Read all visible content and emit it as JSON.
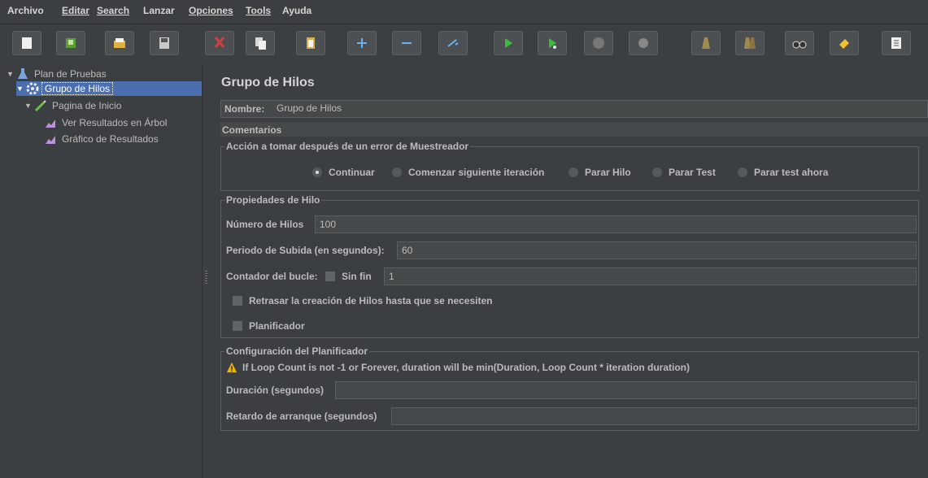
{
  "menu": {
    "items": [
      "Archivo",
      "Editar",
      "Search",
      "Lanzar",
      "Opciones",
      "Tools",
      "Ayuda"
    ]
  },
  "toolbar": {
    "buttons": [
      "new",
      "templates",
      "open",
      "save",
      "cut",
      "copy",
      "paste",
      "expand",
      "collapse",
      "toggle",
      "start",
      "start-no-pauses",
      "stop",
      "shutdown",
      "clear",
      "clear-all",
      "search",
      "reset-search",
      "function-helper"
    ]
  },
  "tree": {
    "plan": "Plan de Pruebas",
    "thread_group": "Grupo de Hilos",
    "sampler": "Pagina de Inicio",
    "listener1": "Ver Resultados en Árbol",
    "listener2": "Gráfico de Resultados"
  },
  "main": {
    "title": "Grupo de Hilos",
    "name_label": "Nombre:",
    "name_value": "Grupo de Hilos",
    "comments_label": "Comentarios",
    "error_action": {
      "title": "Acción a tomar después de un error de Muestreador",
      "options": [
        "Continuar",
        "Comenzar siguiente iteración",
        "Parar Hilo",
        "Parar Test",
        "Parar test ahora"
      ],
      "selected": "Continuar"
    },
    "thread_props": {
      "title": "Propiedades de Hilo",
      "threads_label": "Número de Hilos",
      "threads_value": "100",
      "rampup_label": "Periodo de Subida (en segundos):",
      "rampup_value": "60",
      "loop_label": "Contador del bucle:",
      "forever_label": "Sin fin",
      "loop_value": "1",
      "delay_label": "Retrasar la creación de Hilos hasta que se necesiten",
      "scheduler_label": "Planificador"
    },
    "scheduler": {
      "title": "Configuración del Planificador",
      "warning": "If Loop Count is not -1 or Forever, duration will be min(Duration, Loop Count * iteration duration)",
      "duration_label": "Duración (segundos)",
      "startup_delay_label": "Retardo de arranque (segundos)"
    }
  },
  "colors": {
    "background": "#3c3f41",
    "selection": "#4b6eaf",
    "field": "#45494a"
  }
}
